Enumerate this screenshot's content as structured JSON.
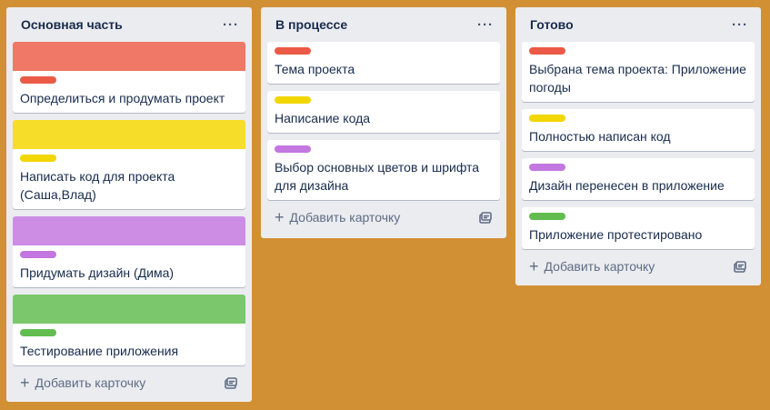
{
  "colors": {
    "board_background": "#d29034",
    "list_background": "#ebecf0",
    "red": "#eb5a46",
    "yellow": "#f2d600",
    "purple": "#c377e0",
    "green": "#61bd4f",
    "cover_red": "#f07866",
    "cover_yellow": "#f5dd29",
    "cover_purple": "#cd8de5",
    "cover_green": "#7bc86c"
  },
  "lists": [
    {
      "title": "Основная часть",
      "menu_icon": "ellipsis-icon",
      "add_card_label": "Добавить карточку",
      "cards": [
        {
          "cover": "cover_red",
          "label": "red",
          "text": "Определиться и продумать проект"
        },
        {
          "cover": "cover_yellow",
          "label": "yellow",
          "text": "Написать код для проекта (Саша,Влад)"
        },
        {
          "cover": "cover_purple",
          "label": "purple",
          "text": "Придумать дизайн (Дима)"
        },
        {
          "cover": "cover_green",
          "label": "green",
          "text": "Тестирование приложения"
        }
      ]
    },
    {
      "title": "В процессе",
      "menu_icon": "ellipsis-icon",
      "add_card_label": "Добавить карточку",
      "cards": [
        {
          "label": "red",
          "text": "Тема проекта"
        },
        {
          "label": "yellow",
          "text": "Написание кода"
        },
        {
          "label": "purple",
          "text": "Выбор основных цветов и шрифта для дизайна"
        }
      ]
    },
    {
      "title": "Готово",
      "menu_icon": "ellipsis-icon",
      "add_card_label": "Добавить карточку",
      "cards": [
        {
          "label": "red",
          "text": "Выбрана тема проекта: Приложение погоды"
        },
        {
          "label": "yellow",
          "text": "Полностью написан код"
        },
        {
          "label": "purple",
          "text": "Дизайн перенесен в приложение"
        },
        {
          "label": "green",
          "text": "Приложение протестировано"
        }
      ]
    }
  ]
}
